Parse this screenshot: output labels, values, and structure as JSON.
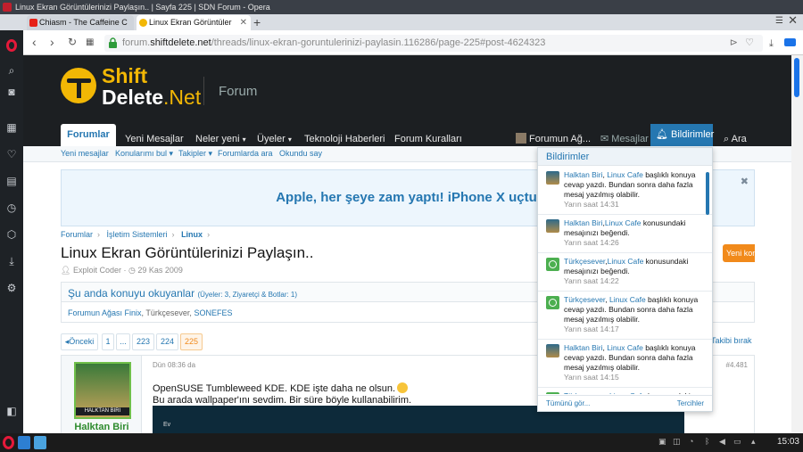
{
  "window": {
    "title": "Linux Ekran Görüntülerinizi Paylaşın.. | Sayfa 225 | SDN Forum - Opera"
  },
  "tabs": [
    {
      "label": "Chiasm - The Caffeine C",
      "color": "#e62117"
    },
    {
      "label": "Linux Ekran Görüntüler",
      "color": "#f2b705"
    }
  ],
  "address": {
    "prefix": "forum.",
    "domain": "shiftdelete.net",
    "path": "/threads/linux-ekran-goruntulerinizi-paylasin.116286/page-225#post-4624323"
  },
  "site": {
    "logo_line1": "Shift",
    "logo_line2a": "Delete",
    "logo_line2b": ".Net",
    "section": "Forum"
  },
  "nav": {
    "forumlar": "Forumlar",
    "yeni_mesajlar": "Yeni Mesajlar",
    "neler_yeni": "Neler yeni",
    "uyeler": "Üyeler",
    "teknoloji": "Teknoloji Haberleri",
    "kurallar": "Forum Kuralları",
    "user": "Forumun Ağ...",
    "mesajlar": "Mesajlar",
    "bildirimler": "Bildirimler",
    "ara": "Ara"
  },
  "subnav": [
    "Yeni mesajlar",
    "Konularımı bul",
    "Takipler",
    "Forumlarda ara",
    "Okundu say"
  ],
  "banner": {
    "text": "Apple, her şeye zam yaptı! iPhone X uçtu!"
  },
  "breadcrumb": [
    "Forumlar",
    "İşletim Sistemleri",
    "Linux"
  ],
  "thread": {
    "title": "Linux Ekran Görüntülerinizi Paylaşın..",
    "author": "Exploit Coder",
    "date": "29 Kas 2009",
    "new_thread_label": "Yeni konu aç"
  },
  "viewers": {
    "heading": "Şu anda konuyu okuyanlar",
    "count": "(Üyeler: 3, Ziyaretçi & Botlar: 1)",
    "names": [
      "Forumun Ağası Finix",
      "Türkçesever",
      "SONEFES"
    ]
  },
  "pagination": {
    "prev": "◂Önceki",
    "pages": [
      "1",
      "...",
      "223",
      "224",
      "225"
    ],
    "current": "225",
    "watch": "Takibi bırak"
  },
  "post": {
    "username": "Halktan Biri",
    "avatar_caption": "HALKTAN BIRI",
    "date": "Dün 08:36 da",
    "number": "#4.481",
    "line1": "OpenSUSE Tumbleweed KDE. KDE işte daha ne olsun.",
    "line2": "Bu arada wallpaper'ını sevdim. Bir süre böyle kullanabilirim.",
    "image_label": "Ev"
  },
  "notifications": {
    "heading": "Bildirimler",
    "items": [
      {
        "avatar": "a",
        "user": "Halktan Biri",
        "sep": ", ",
        "target": "Linux Cafe",
        "text": " başlıklı konuya cevap yazdı. Bundan sonra daha fazla mesaj yazılmış olabilir.",
        "time": "Yarın saat 14:31"
      },
      {
        "avatar": "a",
        "user": "Halktan Biri",
        "sep": ",",
        "target": "Linux Cafe",
        "text": " konusundaki mesajınızı beğendi.",
        "time": "Yarın saat 14:26"
      },
      {
        "avatar": "b",
        "user": "Türkçesever",
        "sep": ",",
        "target": "Linux Cafe",
        "text": " konusundaki mesajınızı beğendi.",
        "time": "Yarın saat 14:22"
      },
      {
        "avatar": "b",
        "user": "Türkçesever",
        "sep": ", ",
        "target": "Linux Cafe",
        "text": " başlıklı konuya cevap yazdı. Bundan sonra daha fazla mesaj yazılmış olabilir.",
        "time": "Yarın saat 14:17"
      },
      {
        "avatar": "a",
        "user": "Halktan Biri",
        "sep": ", ",
        "target": "Linux Cafe",
        "text": " başlıklı konuya cevap yazdı. Bundan sonra daha fazla mesaj yazılmış olabilir.",
        "time": "Yarın saat 14:15"
      },
      {
        "avatar": "b",
        "user": "Türkçesever",
        "sep": ", ",
        "target": "Linux Cafe",
        "text": " konusundaki",
        "time": ""
      }
    ],
    "footer_left": "Tümünü gör...",
    "footer_right": "Tercihler"
  },
  "taskbar": {
    "clock": "15:03"
  }
}
